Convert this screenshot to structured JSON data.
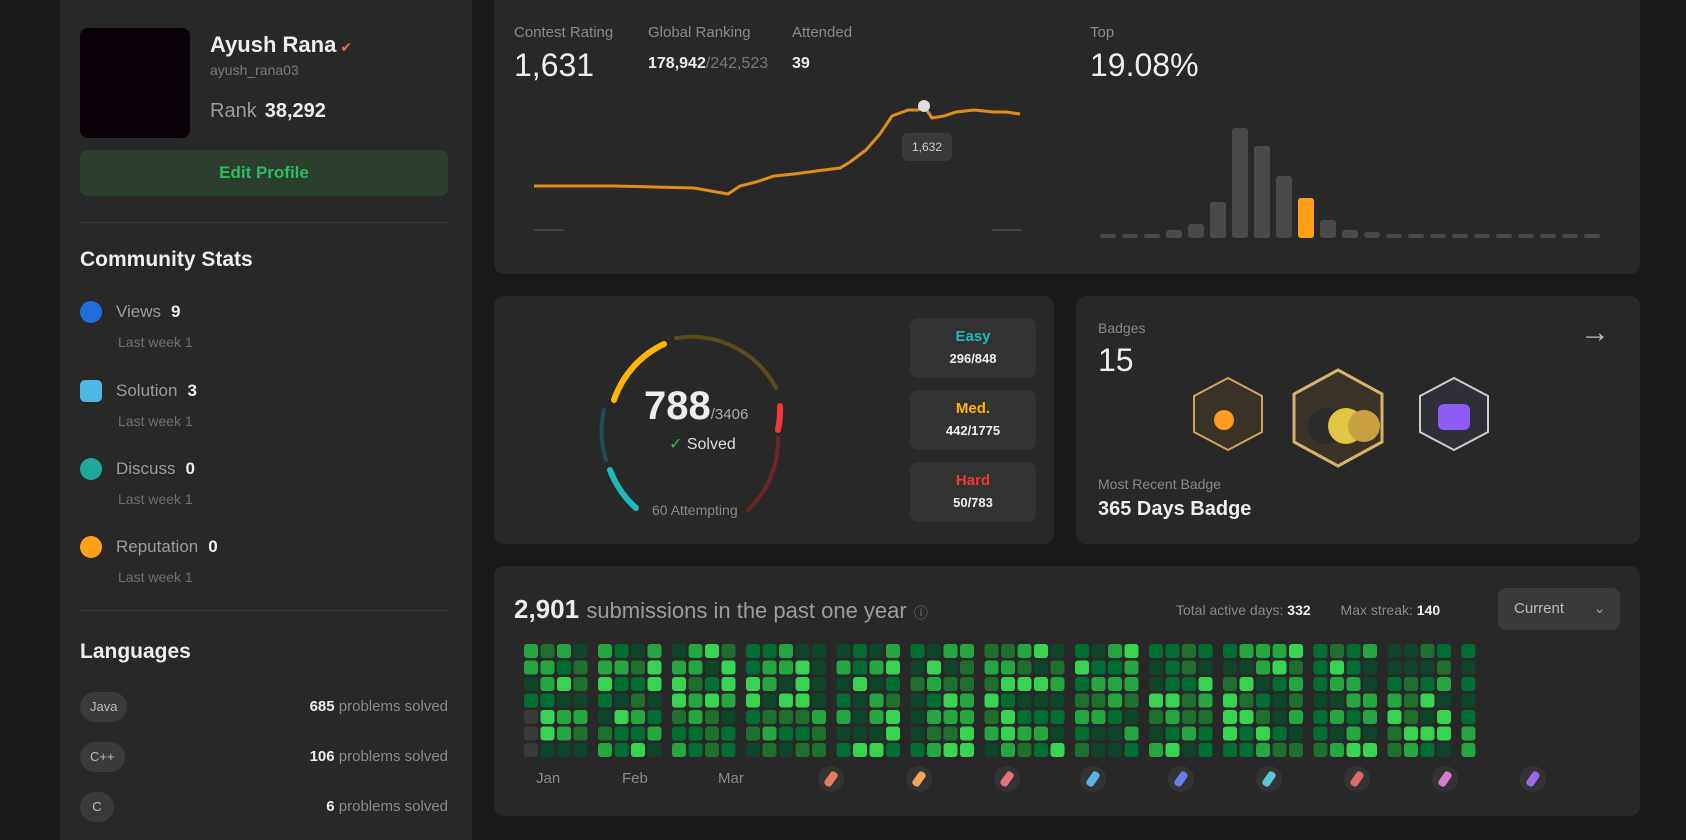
{
  "profile": {
    "name": "Ayush Rana",
    "flag": "✔",
    "handle": "ayush_rana03",
    "rank_label": "Rank",
    "rank_value": "38,292",
    "edit_button": "Edit Profile"
  },
  "community": {
    "title": "Community Stats",
    "items": [
      {
        "label": "Views",
        "value": "9",
        "sub": "Last week 1",
        "color": "#1e6fd9",
        "icon": "eye-icon"
      },
      {
        "label": "Solution",
        "value": "3",
        "sub": "Last week 1",
        "color": "#4fb8e6",
        "icon": "document-icon"
      },
      {
        "label": "Discuss",
        "value": "0",
        "sub": "Last week 1",
        "color": "#1fa89a",
        "icon": "chat-icon"
      },
      {
        "label": "Reputation",
        "value": "0",
        "sub": "Last week 1",
        "color": "#ffa116",
        "icon": "star-icon"
      }
    ]
  },
  "languages": {
    "title": "Languages",
    "items": [
      {
        "name": "Java",
        "count": "685",
        "suffix": "problems solved"
      },
      {
        "name": "C++",
        "count": "106",
        "suffix": "problems solved"
      },
      {
        "name": "C",
        "count": "6",
        "suffix": "problems solved"
      }
    ]
  },
  "contest": {
    "rating_label": "Contest Rating",
    "rating": "1,631",
    "ranking_label": "Global Ranking",
    "ranking": "178,942",
    "ranking_total": "/242,523",
    "attended_label": "Attended",
    "attended": "39",
    "tooltip": "1,632",
    "top_label": "Top",
    "top_value": "19.08%",
    "line_color": "#ffa116"
  },
  "progress": {
    "solved": "788",
    "total": "/3406",
    "solved_label": "Solved",
    "attempting": "60 Attempting",
    "easy": {
      "label": "Easy",
      "count": "296/848",
      "color": "#1cbaba"
    },
    "med": {
      "label": "Med.",
      "count": "442/1775",
      "color": "#ffb700"
    },
    "hard": {
      "label": "Hard",
      "count": "50/783",
      "color": "#f63737"
    }
  },
  "badges": {
    "title": "Badges",
    "count": "15",
    "recent_label": "Most Recent Badge",
    "recent_value": "365 Days Badge"
  },
  "heatmap": {
    "count": "2,901",
    "subtitle": "submissions in the past one year",
    "info": "ⓘ",
    "active_label": "Total active days:",
    "active_value": "332",
    "streak_label": "Max streak:",
    "streak_value": "140",
    "select_value": "Current",
    "months": [
      "Jan",
      "Feb",
      "Mar"
    ]
  }
}
